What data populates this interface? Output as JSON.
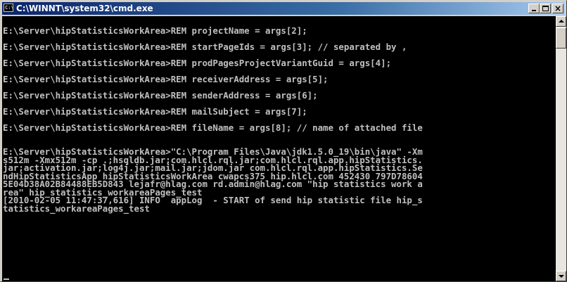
{
  "window": {
    "title": "C:\\WINNT\\system32\\cmd.exe",
    "icon": "cmd-icon",
    "caption_buttons": {
      "minimize": "minimize-icon",
      "maximize": "maximize-icon",
      "close": "×"
    }
  },
  "console": {
    "text": "\nE:\\Server\\hipStatisticsWorkArea>REM projectName = args[2];\n\nE:\\Server\\hipStatisticsWorkArea>REM startPageIds = args[3]; // separated by ,\n\nE:\\Server\\hipStatisticsWorkArea>REM prodPagesProjectVariantGuid = args[4];\n\nE:\\Server\\hipStatisticsWorkArea>REM receiverAddress = args[5];\n\nE:\\Server\\hipStatisticsWorkArea>REM senderAddress = args[6];\n\nE:\\Server\\hipStatisticsWorkArea>REM mailSubject = args[7];\n\nE:\\Server\\hipStatisticsWorkArea>REM fileName = args[8]; // name of attached file\n\n\nE:\\Server\\hipStatisticsWorkArea>\"C:\\Program Files\\Java\\jdk1.5.0_19\\bin\\java\" -Xm\ns512m -Xmx512m -cp .;hsqldb.jar;com.hlcl.rql.jar;com.hlcl.rql.app.hipStatistics.\njar;activation.jar;log4j.jar;mail.jar;jdom.jar com.hlcl.rql.app.hipStatistics.Se\nndHipStatisticsApp hipStatisticsWorkArea cwapcs375 hip.hlcl.com 452430 797D78604\n5E04D38A02B84488EB5D843 lejafr@hlag.com rd.admin@hlag.com \"hip statistics work a\nrea\" hip_statistics_workareaPages_test\n[2010-02-05 11:47:37,616] INFO  appLog  - START of send hip statistic file hip_s\ntatistics_workareaPages_test"
  },
  "scrollbar": {
    "up": "scroll-up-icon",
    "down": "scroll-down-icon"
  }
}
